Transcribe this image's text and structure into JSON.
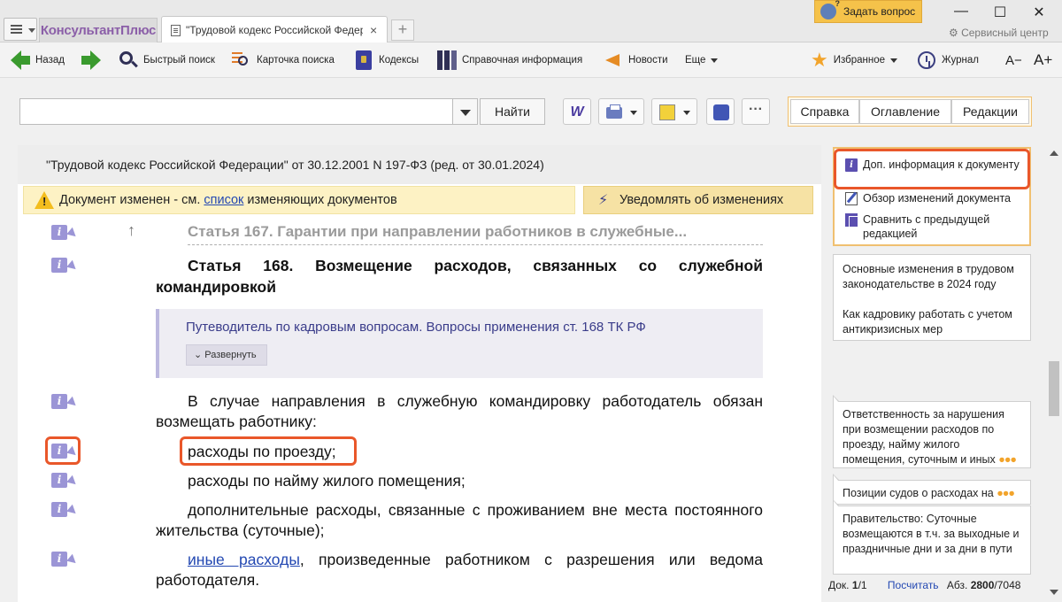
{
  "app": {
    "brand": "КонсультантПлюс",
    "tab_title": "\"Трудовой кодекс Российской Федер",
    "tab_close": "×",
    "new_tab": "+",
    "ask_button": "Задать вопрос",
    "service_center": "Сервисный центр",
    "window_controls": {
      "minimize": "—",
      "maximize": "☐",
      "close": "✕"
    }
  },
  "toolbar": {
    "back": "Назад",
    "quick_search": "Быстрый поиск",
    "search_card": "Карточка поиска",
    "codes": "Кодексы",
    "reference": "Справочная информация",
    "news": "Новости",
    "more": "Еще",
    "favorites": "Избранное",
    "journal": "Журнал",
    "font_smaller": "A−",
    "font_larger": "A+"
  },
  "search": {
    "value": "",
    "placeholder": "",
    "find_button": "Найти",
    "word_label": "W",
    "tabs": [
      "Справка",
      "Оглавление",
      "Редакции"
    ]
  },
  "document": {
    "header": "\"Трудовой кодекс Российской Федерации\" от 30.12.2001 N 197-ФЗ (ред. от 30.01.2024)",
    "notice_prefix": "Документ изменен - см. ",
    "notice_link": "список",
    "notice_suffix": " изменяющих документов",
    "notify_button": "Уведомлять об изменениях",
    "prev_article": "Статья 167. Гарантии при направлении работников в служебные...",
    "article_title": "Статья 168. Возмещение расходов, связанных со служебной командировкой",
    "guide_text": "Путеводитель по кадровым вопросам. Вопросы применения ст. 168 ТК РФ",
    "expand_button": "Развернуть",
    "paragraphs": {
      "p1": "В случае направления в служебную командировку работодатель обязан возмещать работнику:",
      "p2": "расходы по проезду;",
      "p3": "расходы по найму жилого помещения;",
      "p4": "дополнительные расходы, связанные с проживанием вне места постоянного жительства (суточные);",
      "p5_link": "иные расходы",
      "p5_rest": ", произведенные работником с разрешения или ведома работодателя."
    },
    "info_icon_label": "i"
  },
  "right_panel": {
    "info_items": [
      "Доп. информация к документу",
      "Обзор изменений документа",
      "Сравнить с предыдущей редакцией"
    ],
    "links": [
      "Основные изменения в трудовом законодательстве в 2024 году",
      "Как кадровику работать с учетом антикризисных мер"
    ],
    "comments": [
      "Ответственность за нарушения при возмещении расходов по проезду, найму жилого помещения, суточным и иных",
      "Позиции судов о расходах на",
      "Правительство: Суточные возмещаются в т.ч. за выходные и праздничные дни и за дни в пути"
    ],
    "more_dots": "●●●",
    "status": {
      "doc_label": "Док.",
      "doc_current": "1",
      "doc_total": "/1",
      "count_link": "Посчитать",
      "abz_label": "Абз.",
      "abz_current": "2800",
      "abz_total": "/7048"
    }
  },
  "colors": {
    "accent_orange": "#e9572a",
    "brand_purple": "#8b5fa8",
    "link_blue": "#2348b2",
    "notice_yellow": "#fdf2c4",
    "ask_yellow": "#f5c24a"
  }
}
